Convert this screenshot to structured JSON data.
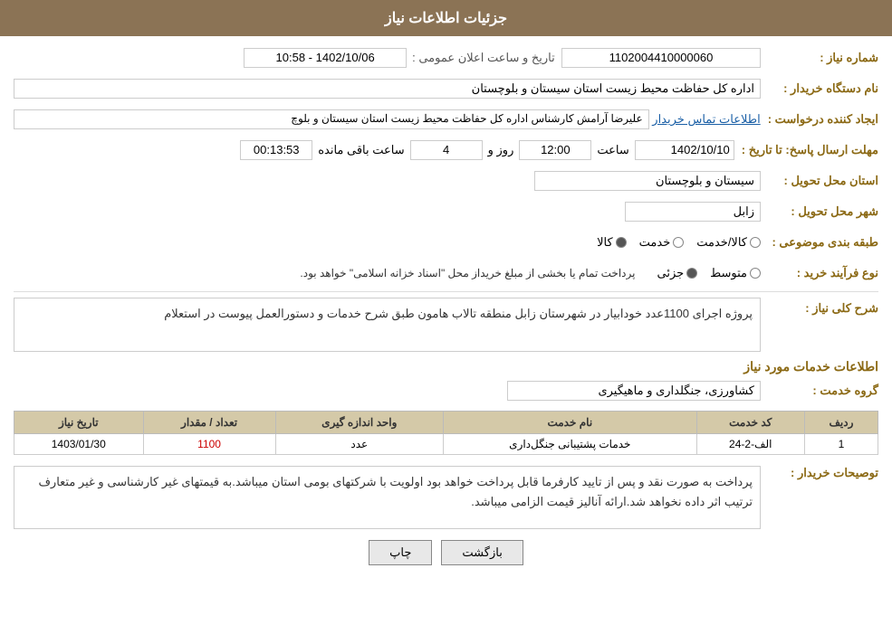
{
  "header": {
    "title": "جزئیات اطلاعات نیاز"
  },
  "labels": {
    "shomara": "شماره نیاز :",
    "nam_dastgah": "نام دستگاه خریدار :",
    "ijad_konande": "ایجاد کننده درخواست :",
    "mohlat": "مهلت ارسال پاسخ: تا تاریخ :",
    "ostan_tahvil": "استان محل تحویل :",
    "shahr_tahvil": "شهر محل تحویل :",
    "tabaghebandi": "طبقه بندی موضوعی :",
    "noe_farayand": "نوع فرآیند خرید :",
    "sharh_koli": "شرح کلی نیاز :",
    "ettelaat_khadamat": "اطلاعات خدمات مورد نیاز",
    "gorohe_khadamat": "گروه خدمت :",
    "tosiyat": "توصیحات خریدار :"
  },
  "fields": {
    "shomara_value": "1102004410000060",
    "tarikh_label": "تاریخ و ساعت اعلان عمومی :",
    "tarikh_value": "1402/10/06 - 10:58",
    "nam_dastgah_value": "اداره کل حفاظت محیط زیست استان سیستان و بلوچستان",
    "ijad_value": "علیرضا آرامش کارشناس اداره کل حفاظت محیط زیست استان سیستان و بلوچ",
    "ijad_link": "اطلاعات تماس خریدار",
    "date1": "1402/10/10",
    "saat": "12:00",
    "roz": "4",
    "baghimande": "00:13:53",
    "ostan_value": "سیستان و بلوچستان",
    "shahr_value": "زابل",
    "tabaghe_kala": "کالا",
    "tabaghe_khadamat": "خدمت",
    "tabaghe_kala_khadamat": "کالا/خدمت",
    "noe_jozvi": "جزئی",
    "noe_motavasset": "متوسط",
    "noe_description": "پرداخت تمام یا بخشی از مبلغ خریداز محل \"اسناد خزانه اسلامی\" خواهد بود.",
    "sharh_value": "پروژه اجرای 1100عدد خودابیار در شهرستان زابل منطقه تالاب هامون طبق شرح خدمات و دستورالعمل پیوست در استعلام",
    "gorohe_value": "کشاورزی، جنگلداری و ماهیگیری"
  },
  "table": {
    "headers": [
      "ردیف",
      "کد خدمت",
      "نام خدمت",
      "واحد اندازه گیری",
      "تعداد / مقدار",
      "تاریخ نیاز"
    ],
    "rows": [
      {
        "radif": "1",
        "code": "الف-2-24",
        "name": "خدمات پشتیبانی جنگل‌داری",
        "unit": "عدد",
        "count": "1100",
        "date": "1403/01/30"
      }
    ]
  },
  "notes": {
    "value": "پرداخت به صورت نقد و پس از تایید کارفرما قابل پرداخت خواهد بود اولویت با شرکتهای بومی استان میباشد.به قیمتهای غیر کارشناسی و غیر متعارف ترتیب اثر داده نخواهد شد.ارائه آنالیز قیمت الزامی میباشد."
  },
  "buttons": {
    "chap": "چاپ",
    "bazgasht": "بازگشت"
  }
}
